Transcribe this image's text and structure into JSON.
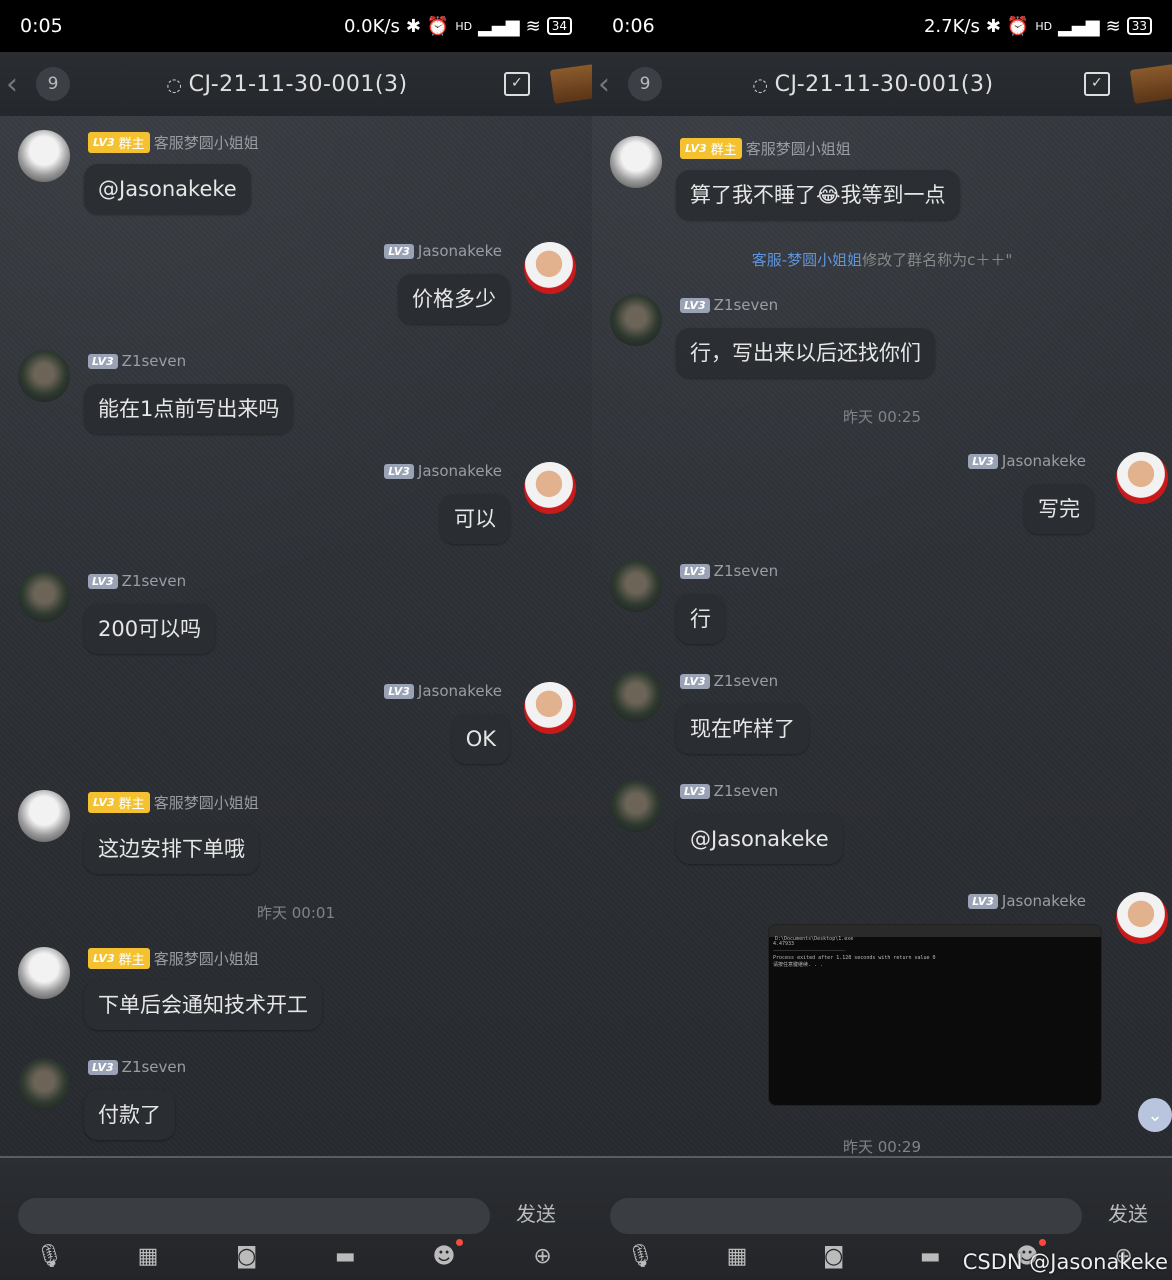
{
  "left": {
    "status": {
      "time": "0:05",
      "speed": "0.0K/s",
      "hd": "HD",
      "battery": "34"
    },
    "nav": {
      "count": "9",
      "title": "CJ-21-11-30-001(3)"
    },
    "messages": [
      {
        "lv": "LV3",
        "role": "群主",
        "name": "客服梦圆小姐姐",
        "text": "@Jasonakeke"
      },
      {
        "lv": "LV3",
        "name": "Jasonakeke",
        "text": "价格多少"
      },
      {
        "lv": "LV3",
        "name": "Z1seven",
        "text": "能在1点前写出来吗"
      },
      {
        "lv": "LV3",
        "name": "Jasonakeke",
        "text": "可以"
      },
      {
        "lv": "LV3",
        "name": "Z1seven",
        "text": "200可以吗"
      },
      {
        "lv": "LV3",
        "name": "Jasonakeke",
        "text": "OK"
      },
      {
        "lv": "LV3",
        "role": "群主",
        "name": "客服梦圆小姐姐",
        "text": "这边安排下单哦"
      },
      {
        "lv": "LV3",
        "role": "群主",
        "name": "客服梦圆小姐姐",
        "text": "下单后会通知技术开工"
      },
      {
        "lv": "LV3",
        "name": "Z1seven",
        "text": "付款了"
      }
    ],
    "timestamp": "昨天 00:01",
    "send_label": "发送"
  },
  "right": {
    "status": {
      "time": "0:06",
      "speed": "2.7K/s",
      "hd": "HD",
      "battery": "33"
    },
    "nav": {
      "count": "9",
      "title": "CJ-21-11-30-001(3)"
    },
    "messages": [
      {
        "lv": "LV3",
        "role": "群主",
        "name": "客服梦圆小姐姐",
        "text_before": "算了我不睡了",
        "emoji": "😂",
        "text_after": "我等到一点"
      },
      {
        "lv": "LV3",
        "name": "Z1seven",
        "text": "行，写出来以后还找你们"
      },
      {
        "lv": "LV3",
        "name": "Jasonakeke",
        "text": "写完"
      },
      {
        "lv": "LV3",
        "name": "Z1seven",
        "text": "行"
      },
      {
        "lv": "LV3",
        "name": "Z1seven",
        "text": "现在咋样了"
      },
      {
        "lv": "LV3",
        "name": "Z1seven",
        "text": "@Jasonakeke"
      },
      {
        "lv": "LV3",
        "name": "Jasonakeke"
      }
    ],
    "notice": {
      "actor": "客服-梦圆小姐姐",
      "rest": "修改了群名称为c＋＋\""
    },
    "timestamp1": "昨天 00:25",
    "timestamp2": "昨天 00:29",
    "image_text": {
      "title": "D:\\Documents\\Desktop\\1.exe",
      "line1": "4.47933",
      "line2": "Process exited after 1.128 seconds with return value 0",
      "line3": "请按任意键继续. . ."
    },
    "send_label": "发送",
    "watermark": "CSDN @Jasonakeke"
  }
}
